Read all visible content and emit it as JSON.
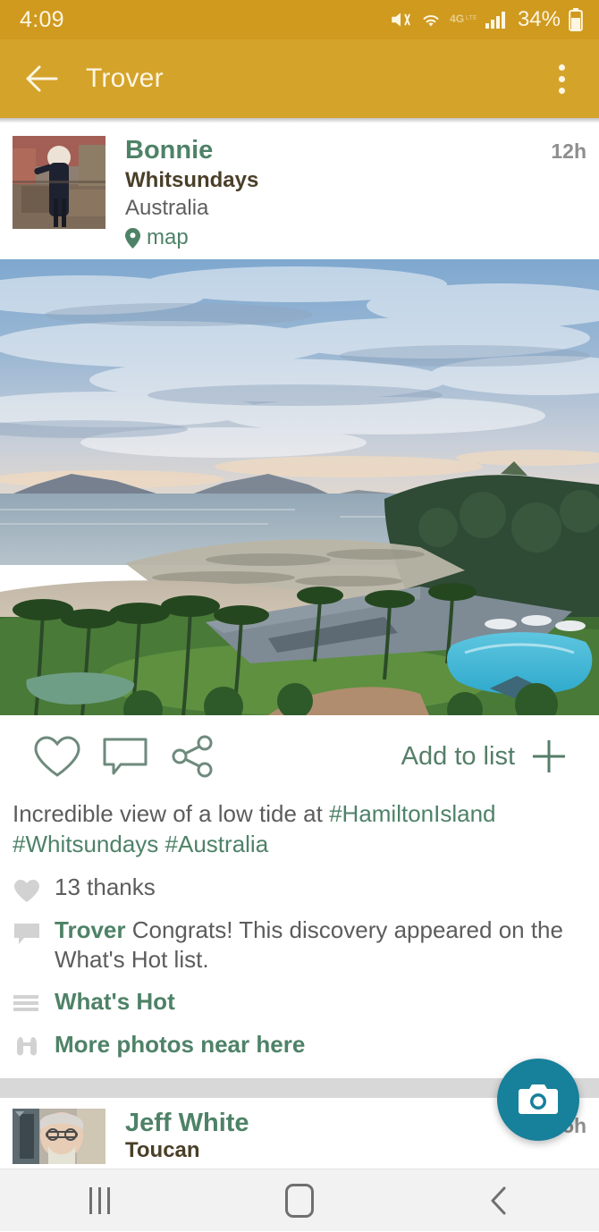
{
  "statusbar": {
    "time": "4:09",
    "battery_percent": "34%",
    "icons": [
      "mute-vibrate-icon",
      "wifi-icon",
      "4g-lte-icon",
      "signal-bars-icon",
      "battery-icon"
    ],
    "network_label": "4G",
    "bg_color": "#cf9a1e"
  },
  "appbar": {
    "title": "Trover",
    "back_icon": "back-arrow-icon",
    "overflow_icon": "overflow-menu-icon",
    "bg_color": "#d4a32a",
    "text_color": "#fdf6e3"
  },
  "post": {
    "author": "Bonnie",
    "place": "Whitsundays",
    "country": "Australia",
    "map_label": "map",
    "timestamp": "12h",
    "photo_alt": "aerial-view-of-resort-and-low-tide-beach",
    "actions": {
      "like_icon": "heart-outline-icon",
      "comment_icon": "comment-bubble-icon",
      "share_icon": "share-icon",
      "add_to_list_label": "Add to list",
      "add_icon": "plus-icon"
    },
    "caption_plain": "Incredible view of a low tide at ",
    "caption_tags": [
      "#HamiltonIsland",
      "#Whitsundays",
      "#Australia"
    ],
    "thanks_count": "13 thanks",
    "comment_author": "Trover",
    "comment_body": "Congrats! This discovery appeared on the What's Hot list.",
    "whats_hot_label": "What's Hot",
    "more_photos_label": "More photos near here"
  },
  "next_post": {
    "author": "Jeff White",
    "place": "Toucan",
    "timestamp": "5h"
  },
  "fab": {
    "icon": "camera-icon",
    "color": "#17809a"
  },
  "navbar": {
    "recents_icon": "recents-icon",
    "home_icon": "home-icon",
    "back_icon": "nav-back-icon"
  },
  "colors": {
    "accent_green": "#4e8267",
    "brand_gold": "#d4a32a",
    "fab_teal": "#17809a"
  }
}
